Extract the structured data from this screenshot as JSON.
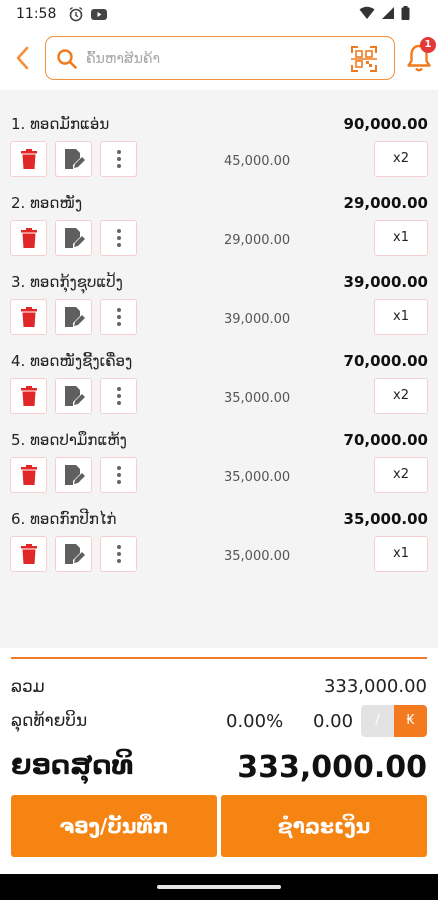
{
  "status_bar": {
    "time": "11:58",
    "icons_left": [
      "alarm-icon",
      "youtube-icon"
    ],
    "icons_right": [
      "wifi-icon",
      "signal-icon",
      "battery-icon"
    ]
  },
  "header": {
    "search_placeholder": "ຄົ້ນຫາສິນຄ້າ",
    "notification_count": "1",
    "accent_color": "#f58413"
  },
  "cart": {
    "items": [
      {
        "name": "1. ທອດມັກແອ່ນ",
        "total": "90,000.00",
        "unit_price": "45,000.00",
        "qty": "x2"
      },
      {
        "name": "2. ທອດໜັງ",
        "total": "29,000.00",
        "unit_price": "29,000.00",
        "qty": "x1"
      },
      {
        "name": "3. ທອດກຸ້ງຊຸບແປ້ງ",
        "total": "39,000.00",
        "unit_price": "39,000.00",
        "qty": "x1"
      },
      {
        "name": "4. ທອດໜັງຊີ້ງເຄື່ອງ",
        "total": "70,000.00",
        "unit_price": "35,000.00",
        "qty": "x2"
      },
      {
        "name": "5. ທອດປາມຶກແຫ້ງ",
        "total": "70,000.00",
        "unit_price": "35,000.00",
        "qty": "x2"
      },
      {
        "name": "6. ທອດກົກປີກໄກ່",
        "total": "35,000.00",
        "unit_price": "35,000.00",
        "qty": "x1"
      }
    ]
  },
  "summary": {
    "subtotal_label": "ລວມ",
    "subtotal_value": "333,000.00",
    "discount_label": "ລຸດທ້າຍບິນ",
    "discount_percent": "0.00%",
    "discount_amount": "0.00",
    "toggle_percent_label": "/",
    "toggle_kip_label": "₭",
    "grand_total_label": "ຍອດສຸດທິ",
    "grand_total_value": "333,000.00"
  },
  "actions": {
    "save_label": "ຈອງ/ບັນທຶກ",
    "pay_label": "ຊຳລະເງິນ"
  }
}
